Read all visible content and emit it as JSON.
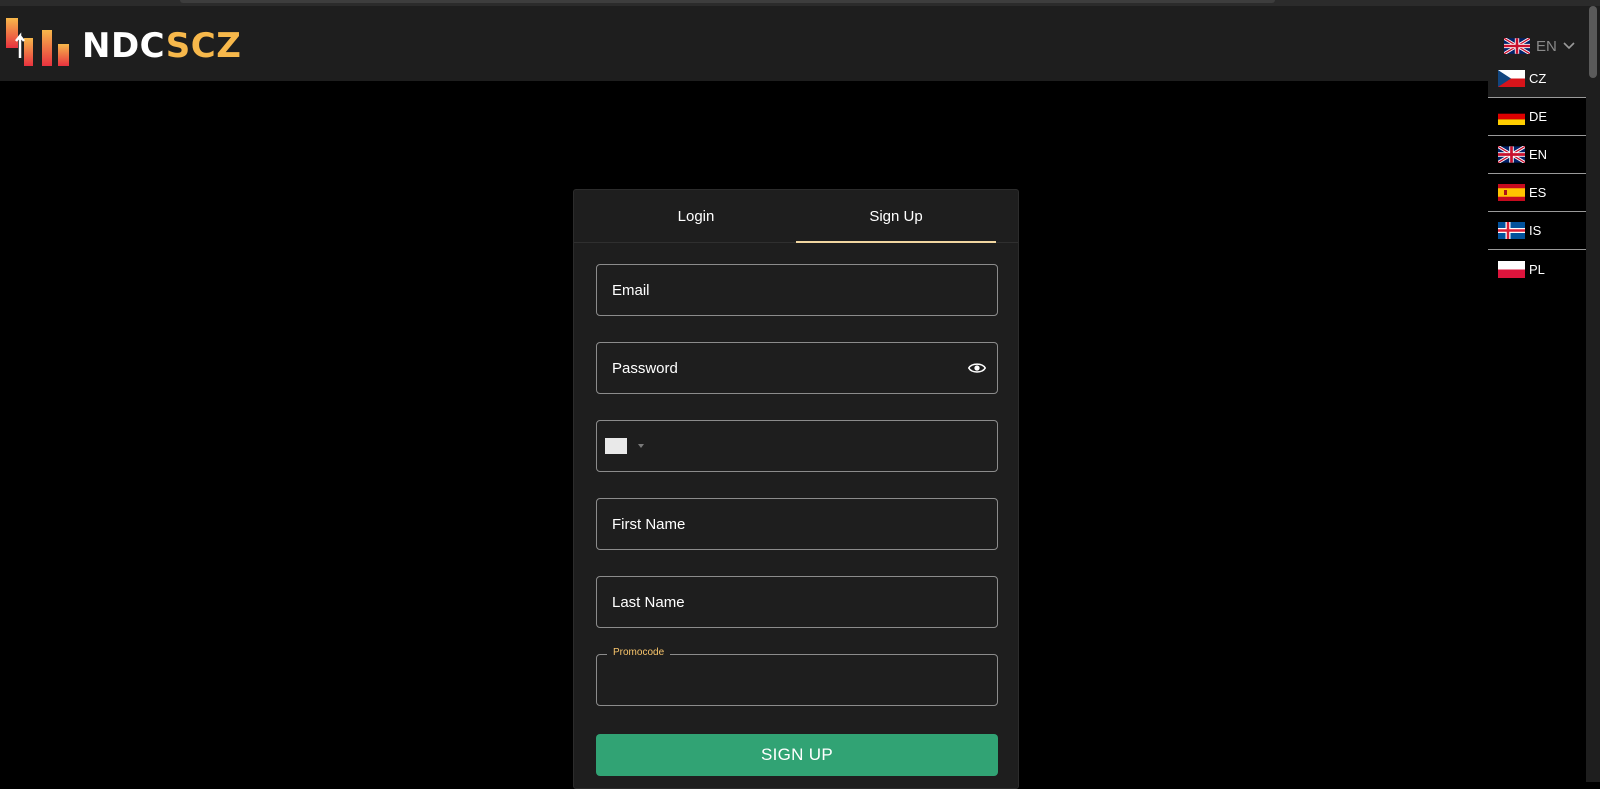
{
  "brand": {
    "part1": "NDC",
    "part2": "SCZ"
  },
  "language": {
    "current": "EN",
    "options": [
      "CZ",
      "DE",
      "EN",
      "ES",
      "IS",
      "PL"
    ]
  },
  "auth": {
    "tabs": {
      "login": "Login",
      "signup": "Sign Up"
    },
    "active_tab": "Sign Up",
    "fields": {
      "email": "Email",
      "password": "Password",
      "first_name": "First Name",
      "last_name": "Last Name",
      "promocode": "Promocode"
    },
    "submit": "SIGN UP"
  },
  "colors": {
    "accent": "#f7b84b",
    "button": "#31a374",
    "panel": "#1e1e1e",
    "background": "#000000"
  },
  "icons": [
    "logo-mark",
    "uk-flag-icon",
    "chevron-down-icon",
    "eye-icon",
    "country-flag-icon"
  ]
}
